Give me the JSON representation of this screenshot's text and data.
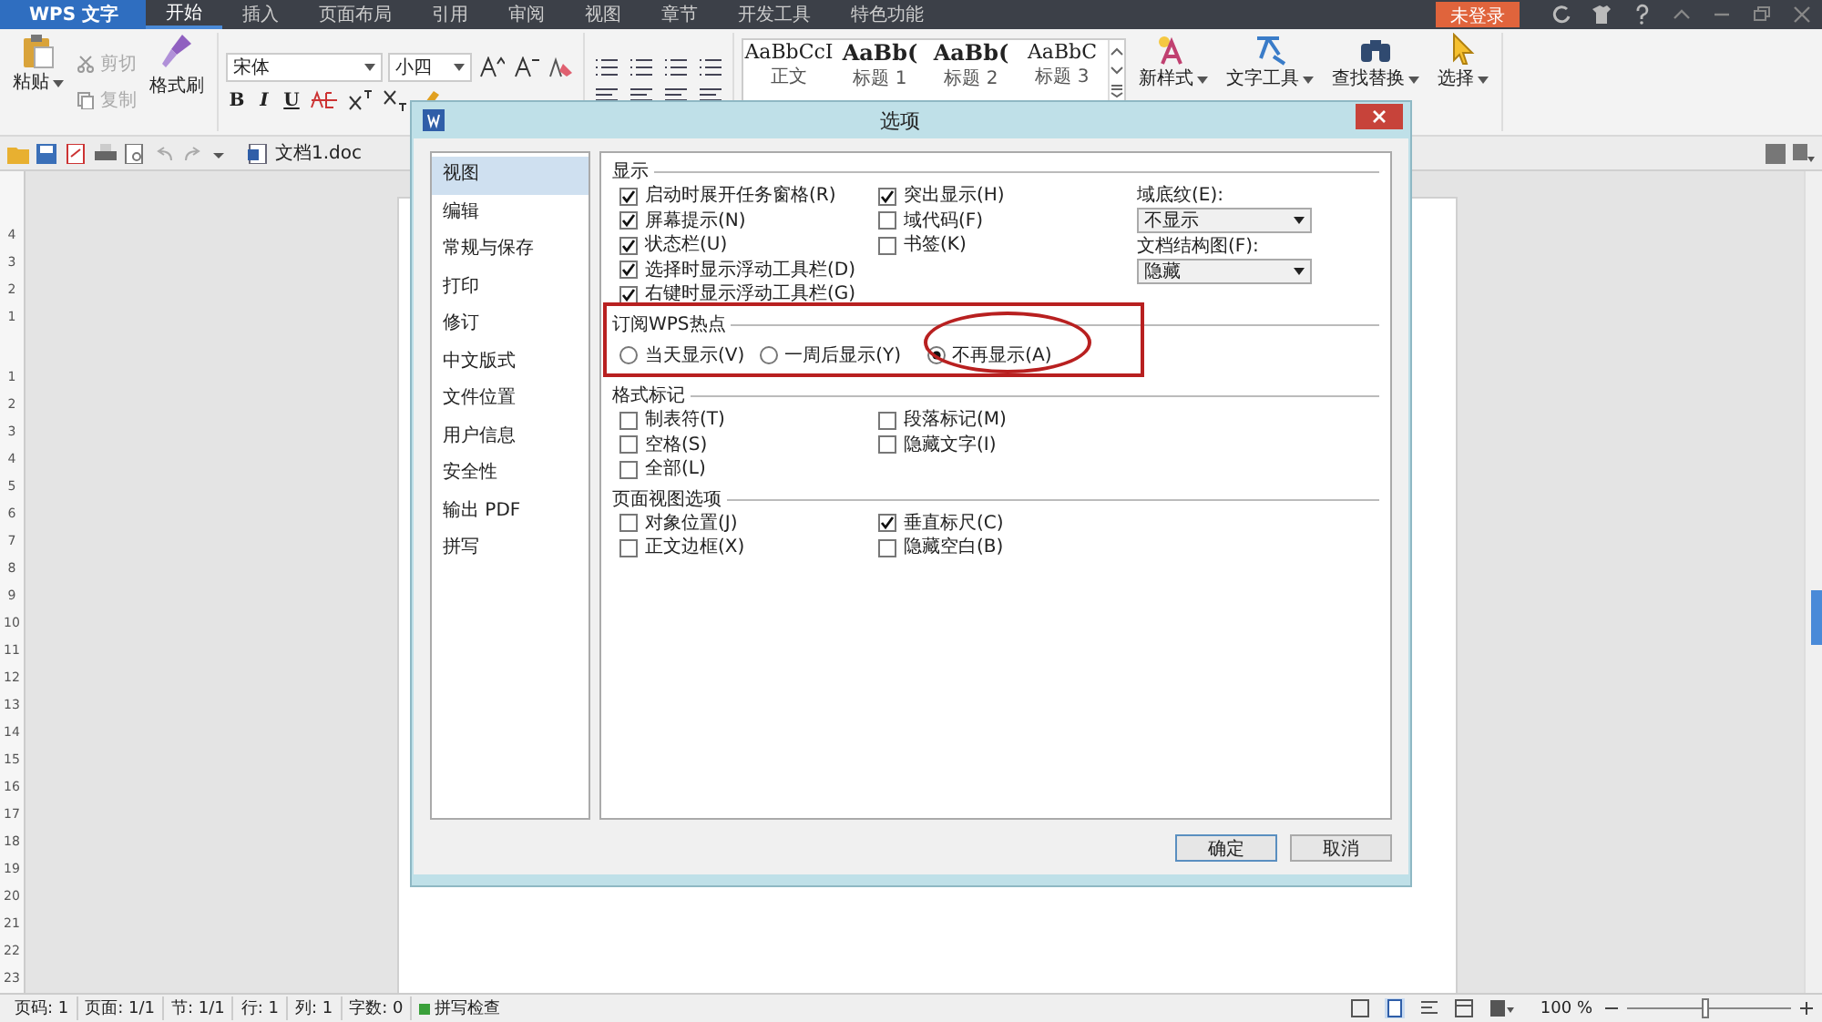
{
  "app_button": {
    "label": "WPS 文字"
  },
  "tabs": [
    {
      "label": "开始",
      "selected": true
    },
    {
      "label": "插入",
      "selected": false
    },
    {
      "label": "页面布局",
      "selected": false
    },
    {
      "label": "引用",
      "selected": false
    },
    {
      "label": "审阅",
      "selected": false
    },
    {
      "label": "视图",
      "selected": false
    },
    {
      "label": "章节",
      "selected": false
    },
    {
      "label": "开发工具",
      "selected": false
    },
    {
      "label": "特色功能",
      "selected": false
    }
  ],
  "login_button": {
    "label": "未登录"
  },
  "ribbon": {
    "paste": "粘贴",
    "cut": {
      "label": "剪切",
      "disabled": true
    },
    "copy": {
      "label": "复制",
      "disabled": true
    },
    "format_painter": "格式刷",
    "font": {
      "value": "宋体"
    },
    "size": {
      "value": "小四"
    },
    "format_buttons": [
      "B",
      "I",
      "U"
    ],
    "styles": [
      {
        "sample": "AaBbCcI",
        "label": "正文"
      },
      {
        "sample": "AaBb(",
        "label": "标题 1"
      },
      {
        "sample": "AaBb(",
        "label": "标题 2"
      },
      {
        "sample": "AaBbC",
        "label": "标题 3"
      }
    ],
    "new_style": "新样式",
    "text_tools": "文字工具",
    "find_replace": "查找替换",
    "select": "选择"
  },
  "document_tab": {
    "label": "文档1.doc"
  },
  "ruler_numbers": [
    "4",
    "3",
    "2",
    "1",
    "1",
    "2",
    "3",
    "4",
    "5",
    "6",
    "7",
    "8",
    "9",
    "10",
    "11",
    "12",
    "13",
    "14",
    "15",
    "16",
    "17",
    "18",
    "19",
    "20",
    "21",
    "22",
    "23"
  ],
  "dialog": {
    "title": "选项",
    "categories": [
      {
        "label": "视图",
        "selected": true
      },
      {
        "label": "编辑",
        "selected": false
      },
      {
        "label": "常规与保存",
        "selected": false
      },
      {
        "label": "打印",
        "selected": false
      },
      {
        "label": "修订",
        "selected": false
      },
      {
        "label": "中文版式",
        "selected": false
      },
      {
        "label": "文件位置",
        "selected": false
      },
      {
        "label": "用户信息",
        "selected": false
      },
      {
        "label": "安全性",
        "selected": false
      },
      {
        "label": "输出 PDF",
        "selected": false
      },
      {
        "label": "拼写",
        "selected": false
      }
    ],
    "sections": [
      {
        "title": "显示",
        "kind": "checks",
        "columns": [
          [
            {
              "label": "启动时展开任务窗格(R)",
              "checked": true
            },
            {
              "label": "屏幕提示(N)",
              "checked": true
            },
            {
              "label": "状态栏(U)",
              "checked": true
            },
            {
              "label": "选择时显示浮动工具栏(D)",
              "checked": true
            },
            {
              "label": "右键时显示浮动工具栏(G)",
              "checked": true
            }
          ],
          [
            {
              "label": "突出显示(H)",
              "checked": true
            },
            {
              "label": "域代码(F)",
              "checked": false
            },
            {
              "label": "书签(K)",
              "checked": false
            }
          ]
        ],
        "dropdowns": [
          {
            "label": "域底纹(E):",
            "value": "不显示"
          },
          {
            "label": "文档结构图(F):",
            "value": "隐藏"
          }
        ]
      },
      {
        "title": "订阅WPS热点",
        "kind": "radios",
        "options": [
          {
            "label": "当天显示(V)",
            "selected": false
          },
          {
            "label": "一周后显示(Y)",
            "selected": false
          },
          {
            "label": "不再显示(A)",
            "selected": true
          }
        ]
      },
      {
        "title": "格式标记",
        "kind": "checks",
        "columns": [
          [
            {
              "label": "制表符(T)",
              "checked": false
            },
            {
              "label": "空格(S)",
              "checked": false
            },
            {
              "label": "全部(L)",
              "checked": false
            }
          ],
          [
            {
              "label": "段落标记(M)",
              "checked": false
            },
            {
              "label": "隐藏文字(I)",
              "checked": false
            }
          ]
        ]
      },
      {
        "title": "页面视图选项",
        "kind": "checks",
        "columns": [
          [
            {
              "label": "对象位置(J)",
              "checked": false
            },
            {
              "label": "正文边框(X)",
              "checked": false
            }
          ],
          [
            {
              "label": "垂直标尺(C)",
              "checked": true
            },
            {
              "label": "隐藏空白(B)",
              "checked": false
            }
          ]
        ]
      }
    ],
    "buttons": [
      "确定",
      "取消"
    ]
  },
  "status_bar": {
    "items": [
      "页码: 1",
      "页面: 1/1",
      "节: 1/1",
      "行: 1",
      "列: 1",
      "字数: 0"
    ],
    "spell_check": "拼写检查",
    "zoom": "100 %",
    "zoom_slider": {
      "level": 0.48
    }
  }
}
